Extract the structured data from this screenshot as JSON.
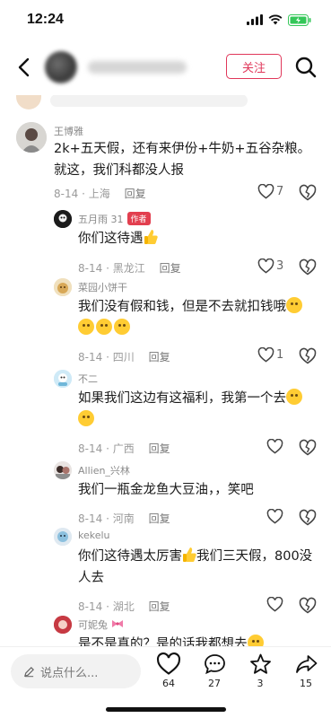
{
  "status_bar": {
    "time": "12:24"
  },
  "header": {
    "follow_label": "关注"
  },
  "comments": [
    {
      "name": "王博雅",
      "text": "2k+五天假，还有来伊份+牛奶+五谷杂粮。就这，我们科都没人报",
      "date": "8-14",
      "location": "上海",
      "reply": "回复",
      "likes": "7"
    },
    {
      "name": "五月雨 31",
      "author_tag": "作者",
      "text": "你们这待遇",
      "date": "8-14",
      "location": "黑龙江",
      "reply": "回复",
      "likes": "3"
    },
    {
      "name": "菜园小饼干",
      "text": "我们没有假和钱，但是不去就扣钱哦",
      "date": "8-14",
      "location": "四川",
      "reply": "回复",
      "likes": "1"
    },
    {
      "name": "不二",
      "text": "如果我们这边有这福利，我第一个去",
      "date": "8-14",
      "location": "广西",
      "reply": "回复",
      "likes": ""
    },
    {
      "name": "Allien_兴林",
      "text": "我们一瓶金龙鱼大豆油，，笑吧",
      "date": "8-14",
      "location": "河南",
      "reply": "回复",
      "likes": ""
    },
    {
      "name": "kekelu",
      "text_a": "你们这待遇太厉害",
      "text_b": "我们三天假，800没人去",
      "date": "8-14",
      "location": "湖北",
      "reply": "回复",
      "likes": ""
    },
    {
      "name": "可妮兔",
      "text": "是不是真的？是的话我都想去"
    }
  ],
  "bottom_bar": {
    "input_placeholder": "说点什么...",
    "likes_count": "64",
    "comments_count": "27",
    "favorites_count": "3",
    "shares_count": "15"
  },
  "colors": {
    "accent": "#e0375a",
    "author_tag": "#e23f4f",
    "battery": "#35c759"
  },
  "icons": [
    "back-icon",
    "search-icon",
    "heart-icon",
    "broken-heart-icon",
    "comment-icon",
    "star-icon",
    "share-icon",
    "pencil-icon",
    "signal-icon",
    "wifi-icon",
    "battery-icon"
  ]
}
